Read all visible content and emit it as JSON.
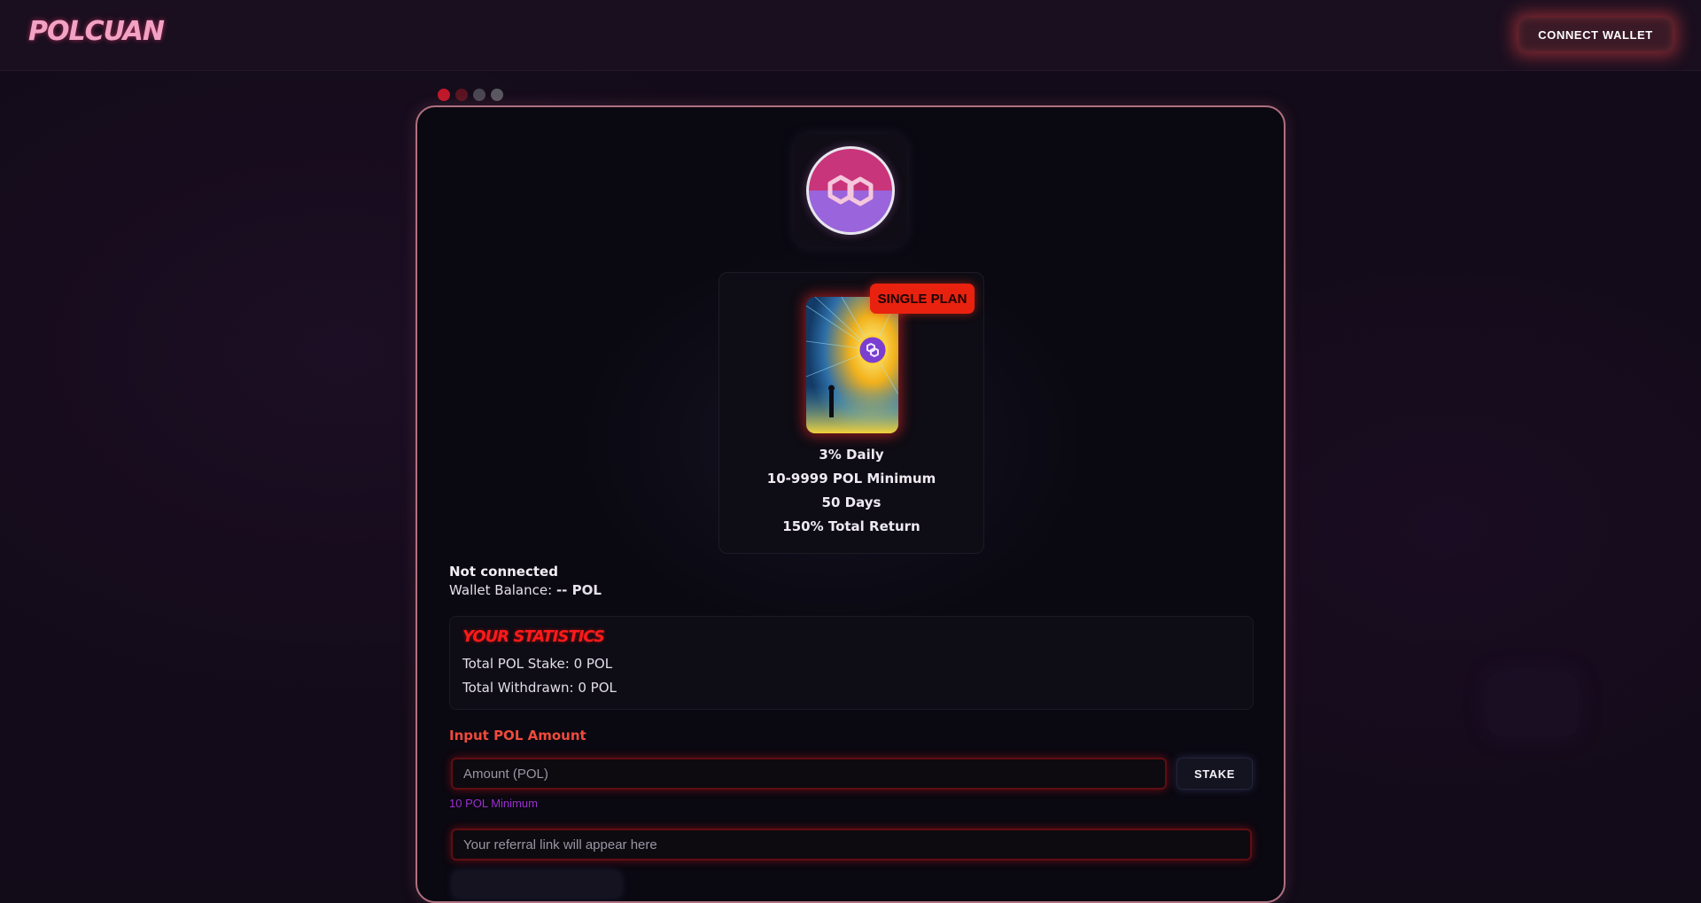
{
  "header": {
    "logo_text": "POLCUAN",
    "connect_label": "CONNECT WALLET"
  },
  "slider": {
    "dots": [
      "#c0182a",
      "#5a1420",
      "#4a4752",
      "#5a5862"
    ]
  },
  "token": {
    "icon": "polygon-logo-icon"
  },
  "plan": {
    "badge": "SINGLE PLAN",
    "image": "polygon-art-image",
    "lines": [
      "3% Daily",
      "10-9999 POL Minimum",
      "50 Days",
      "150% Total Return"
    ]
  },
  "wallet": {
    "status": "Not connected",
    "balance_label": "Wallet Balance:",
    "balance_value": "-- POL"
  },
  "stats": {
    "title": "YOUR STATISTICS",
    "total_stake": "Total POL Stake: 0 POL",
    "total_withdrawn": "Total Withdrawn: 0 POL"
  },
  "form": {
    "input_label": "Input POL Amount",
    "amount_placeholder": "Amount (POL)",
    "stake_label": "STAKE",
    "min_note": "10 POL Minimum",
    "referral_placeholder": "Your referral link will appear here"
  },
  "colors": {
    "accent_red": "#e8220f",
    "panel_border": "#b07080",
    "min_note": "#9b2fd0"
  }
}
